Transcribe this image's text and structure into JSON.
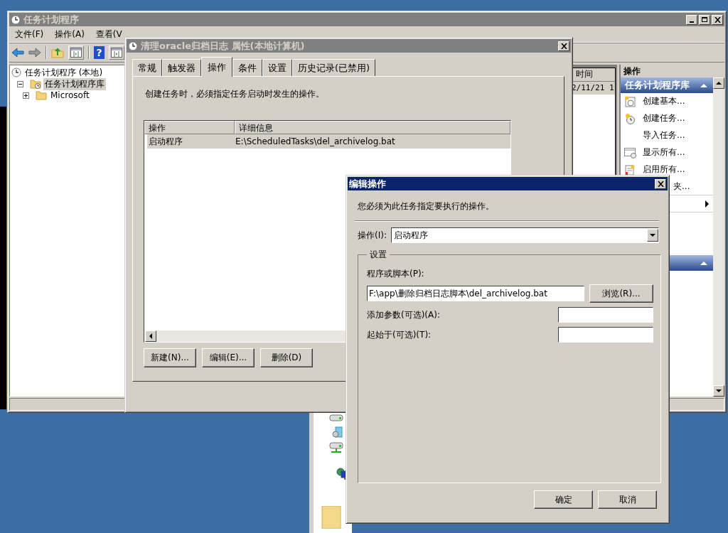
{
  "main_window": {
    "title": "任务计划程序",
    "active": false,
    "menu": [
      "文件(F)",
      "操作(A)",
      "查看(V"
    ],
    "toolbar": [
      {
        "kind": "back"
      },
      {
        "kind": "forward"
      },
      {
        "kind": "folder-up"
      },
      {
        "kind": "pane"
      },
      {
        "kind": "help",
        "glyph": "?"
      },
      {
        "kind": "pane"
      }
    ],
    "tree": [
      {
        "label": "任务计划程序 (本地)",
        "selected": false,
        "children": [
          {
            "label": "任务计划程序库",
            "selected": true,
            "expanded": true,
            "children": [
              {
                "label": "Microsoft",
                "selected": false,
                "expanded": false
              }
            ]
          }
        ]
      }
    ],
    "task_list": {
      "column": "时间",
      "rows": [
        {
          "cell": "2/11/21 1",
          "selected": true
        }
      ]
    },
    "actions_pane": {
      "title": "操作",
      "sections": [
        {
          "title": "任务计划程序库",
          "expanded": true,
          "items": [
            {
              "label": "创建基本...",
              "kind": "calendar-clock"
            },
            {
              "label": "创建任务...",
              "kind": "star-clock"
            },
            {
              "label": "导入任务...",
              "kind": "plain"
            },
            {
              "label": "显示所有...",
              "kind": "window-clock"
            },
            {
              "label": "启用所有...",
              "kind": "notepad"
            },
            {
              "label": "夹...",
              "kind": "clipped"
            },
            {
              "kind": "submenu"
            }
          ]
        },
        {
          "expanded": true
        }
      ]
    }
  },
  "properties_dialog": {
    "title": "清理oracle归档日志 属性(本地计算机)",
    "active": false,
    "tabs": [
      {
        "label": "常规",
        "selected": false
      },
      {
        "label": "触发器",
        "selected": false
      },
      {
        "label": "操作",
        "selected": true
      },
      {
        "label": "条件",
        "selected": false
      },
      {
        "label": "设置",
        "selected": false
      },
      {
        "label": "历史记录(已禁用)",
        "selected": false
      }
    ],
    "description": "创建任务时，必须指定任务启动时发生的操作。",
    "actions_table": {
      "columns": [
        "操作",
        "详细信息"
      ],
      "rows": [
        {
          "cells": [
            "启动程序",
            "E:\\ScheduledTasks\\del_archivelog.bat"
          ],
          "selected": true
        }
      ]
    },
    "buttons": [
      "新建(N)...",
      "编辑(E)...",
      "删除(D)"
    ]
  },
  "edit_dialog": {
    "title": "编辑操作",
    "active": true,
    "instruction": "您必须为此任务指定要执行的操作。",
    "action_field": {
      "label": "操作(I):",
      "value": "启动程序"
    },
    "settings": {
      "title": "设置",
      "program": {
        "label": "程序或脚本(P):",
        "value": "F:\\app\\删除归档日志脚本\\del_archivelog.bat",
        "browse_button": "浏览(R)..."
      },
      "arguments": {
        "label": "添加参数(可选)(A):"
      },
      "start_in": {
        "label": "起始于(可选)(T):"
      }
    },
    "buttons": [
      "确定",
      "取消"
    ]
  },
  "background_window": {
    "items": [
      {
        "kind": "drive"
      },
      {
        "kind": "disc"
      },
      {
        "kind": "network-drive"
      },
      {
        "kind": "globe"
      },
      {
        "kind": "folder"
      }
    ]
  }
}
